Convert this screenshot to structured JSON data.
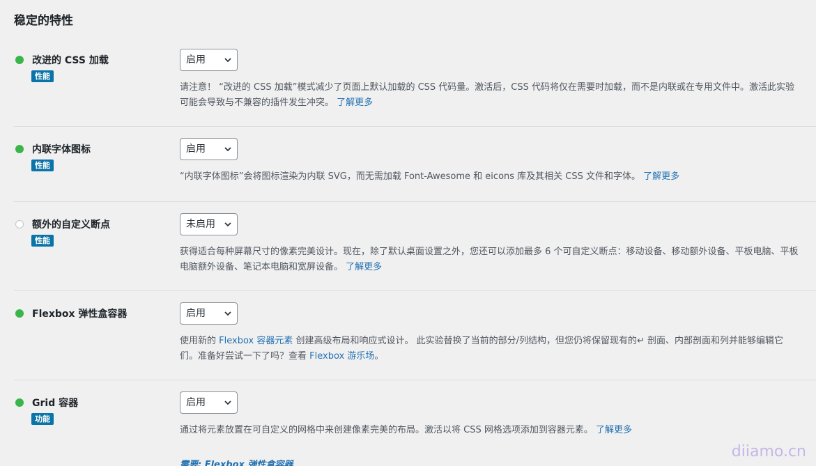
{
  "section": {
    "title": "稳定的特性"
  },
  "features": [
    {
      "name": "改进的 CSS 加载",
      "tag": "性能",
      "status": "enabled",
      "select_value": "启用",
      "desc_text": "请注意！ “改进的 CSS 加载”模式减少了页面上默认加载的 CSS 代码量。激活后，CSS 代码将仅在需要时加载，而不是内联或在专用文件中。激活此实验可能会导致与不兼容的插件发生冲突。",
      "learn_more": "了解更多"
    },
    {
      "name": "内联字体图标",
      "tag": "性能",
      "status": "enabled",
      "select_value": "启用",
      "desc_text": "“内联字体图标”会将图标渲染为内联 SVG，而无需加载 Font-Awesome 和 eicons 库及其相关 CSS 文件和字体。",
      "learn_more": "了解更多"
    },
    {
      "name": "额外的自定义断点",
      "tag": "性能",
      "status": "disabled",
      "select_value": "未启用",
      "desc_text": "获得适合每种屏幕尺寸的像素完美设计。现在，除了默认桌面设置之外，您还可以添加最多 6 个可自定义断点：移动设备、移动额外设备、平板电脑、平板电脑额外设备、笔记本电脑和宽屏设备。",
      "learn_more": "了解更多"
    },
    {
      "name": "Flexbox 弹性盒容器",
      "tag": "",
      "status": "enabled",
      "select_value": "启用",
      "desc_pre": "使用新的 ",
      "desc_link1": "Flexbox 容器元素",
      "desc_mid": " 创建高级布局和响应式设计。 此实验替换了当前的部分/列结构，但您仍将保留现有的↵ 剖面、内部剖面和列并能够编辑它们。准备好尝试一下了吗？查看 ",
      "desc_link2": "Flexbox 游乐场",
      "desc_post": "。"
    },
    {
      "name": "Grid 容器",
      "tag": "功能",
      "status": "enabled",
      "select_value": "启用",
      "desc_text": "通过将元素放置在可自定义的网格中来创建像素完美的布局。激活以将 CSS 网格选项添加到容器元素。",
      "learn_more": "了解更多",
      "requires": "需要: Flexbox 弹性盒容器"
    }
  ],
  "watermark": "diiamo.cn",
  "colors": {
    "enabled_dot": "#39b54a",
    "tag_bg": "#0a73a8",
    "link": "#2271b1"
  }
}
